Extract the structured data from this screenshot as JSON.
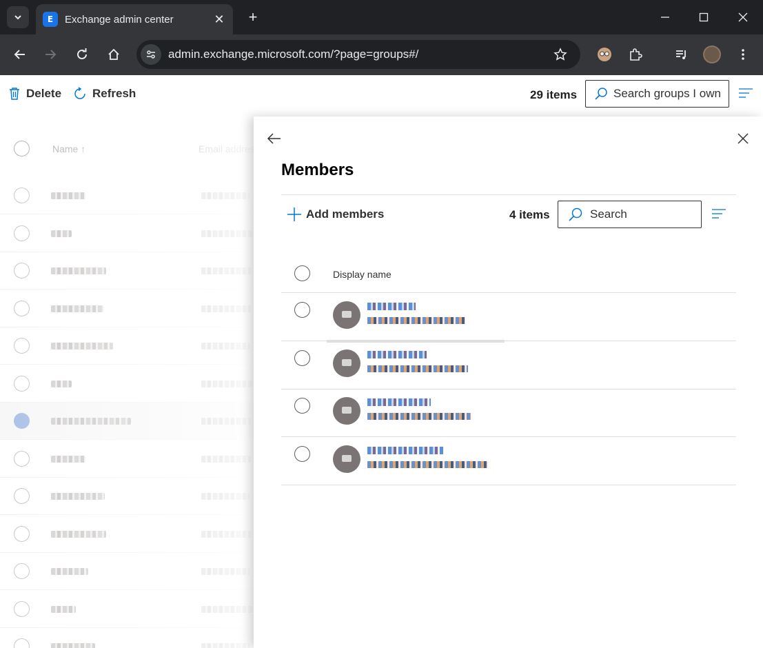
{
  "browser": {
    "tab_title": "Exchange admin center",
    "tab_favicon_letter": "E",
    "url": "admin.exchange.microsoft.com/?page=groups#/"
  },
  "page": {
    "toolbar": {
      "delete_label": "Delete",
      "refresh_label": "Refresh"
    },
    "items_count": "29 items",
    "search_placeholder": "Search groups I own",
    "columns": {
      "name": "Name ↑",
      "email": "Email address"
    }
  },
  "panel": {
    "title": "Members",
    "add_members_label": "Add members",
    "items_count": "4 items",
    "search_placeholder": "Search",
    "column_display_name": "Display name"
  },
  "colors": {
    "accent": "#0078d4",
    "chrome_dark": "#202124",
    "chrome_toolbar": "#35363a"
  }
}
